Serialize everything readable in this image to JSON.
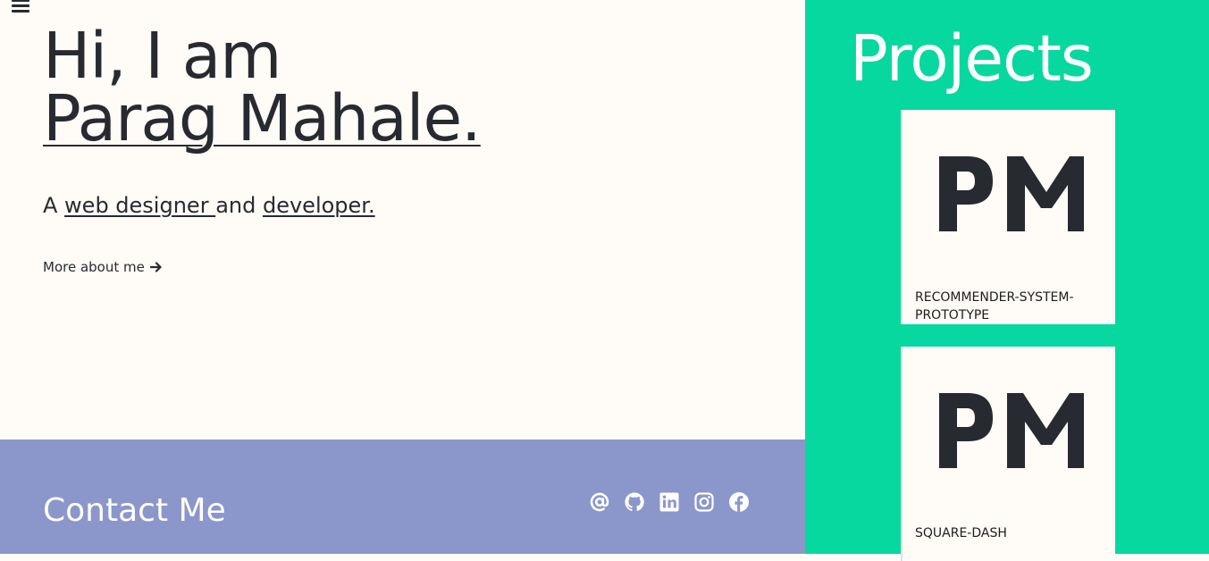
{
  "nav": {
    "menu_icon": "hamburger-icon"
  },
  "hero": {
    "greeting": "Hi, I am",
    "name": "Parag Mahale.",
    "tagline_prefix": "A ",
    "tagline_role1": "web designer ",
    "tagline_mid": "and ",
    "tagline_role2": "developer.",
    "more_link": "More about me",
    "more_icon": "arrow-right-icon"
  },
  "contact": {
    "title": "Contact Me",
    "social": [
      {
        "name": "email",
        "icon": "at-icon"
      },
      {
        "name": "github",
        "icon": "github-icon"
      },
      {
        "name": "linkedin",
        "icon": "linkedin-icon"
      },
      {
        "name": "instagram",
        "icon": "instagram-icon"
      },
      {
        "name": "facebook",
        "icon": "facebook-icon"
      }
    ]
  },
  "projects": {
    "title": "Projects",
    "items": [
      {
        "logo_text": "PM",
        "name": "RECOMMENDER-SYSTEM-PROTOTYPE"
      },
      {
        "logo_text": "PM",
        "name": "SQUARE-DASH"
      }
    ]
  },
  "colors": {
    "background": "#fffbf7",
    "text": "#272a30",
    "contact_bg": "#8b97ca",
    "projects_bg": "#06d89f"
  }
}
